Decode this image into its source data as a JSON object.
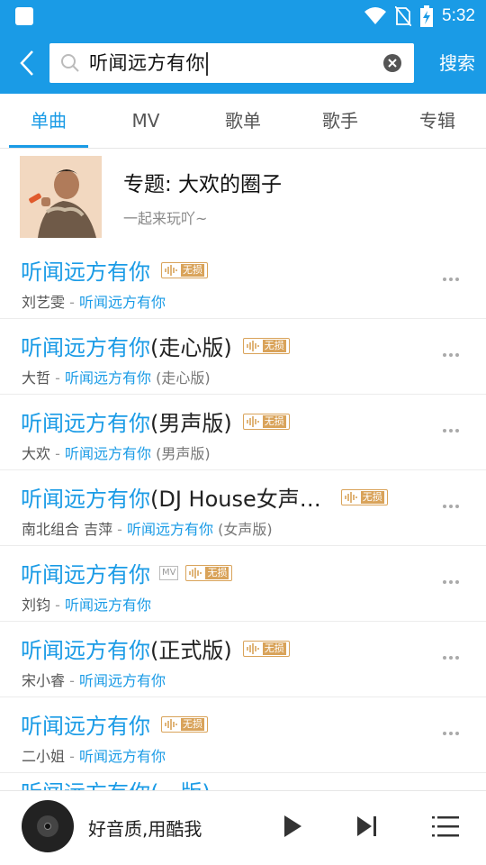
{
  "status_bar": {
    "time": "5:32"
  },
  "search": {
    "query": "听闻远方有你",
    "button_label": "搜索"
  },
  "tabs": [
    {
      "label": "单曲",
      "active": true
    },
    {
      "label": "MV",
      "active": false
    },
    {
      "label": "歌单",
      "active": false
    },
    {
      "label": "歌手",
      "active": false
    },
    {
      "label": "专辑",
      "active": false
    }
  ],
  "topic": {
    "title": "专题: 大欢的圈子",
    "subtitle": "一起来玩吖~"
  },
  "songs": [
    {
      "title_hl": "听闻远方有你",
      "title_rest": "",
      "artist": "刘艺雯",
      "album_hl": "听闻远方有你",
      "album_rest": "",
      "badge": "无损",
      "mv": ""
    },
    {
      "title_hl": "听闻远方有你",
      "title_rest": "(走心版)",
      "artist": "大哲",
      "album_hl": "听闻远方有你",
      "album_rest": " (走心版)",
      "badge": "无损",
      "mv": ""
    },
    {
      "title_hl": "听闻远方有你",
      "title_rest": "(男声版)",
      "artist": "大欢",
      "album_hl": "听闻远方有你",
      "album_rest": " (男声版)",
      "badge": "无损",
      "mv": ""
    },
    {
      "title_hl": "听闻远方有你",
      "title_rest": "(DJ House女声…",
      "artist": "南北组合 吉萍",
      "album_hl": "听闻远方有你",
      "album_rest": " (女声版)",
      "badge": "无损",
      "mv": ""
    },
    {
      "title_hl": "听闻远方有你",
      "title_rest": "",
      "artist": "刘钧",
      "album_hl": "听闻远方有你",
      "album_rest": "",
      "badge": "无损",
      "mv": "MV"
    },
    {
      "title_hl": "听闻远方有你",
      "title_rest": "(正式版)",
      "artist": "宋小睿",
      "album_hl": "听闻远方有你",
      "album_rest": "",
      "badge": "无损",
      "mv": ""
    },
    {
      "title_hl": "听闻远方有你",
      "title_rest": "",
      "artist": "二小姐",
      "album_hl": "听闻远方有你",
      "album_rest": "",
      "badge": "无损",
      "mv": ""
    }
  ],
  "partial_row": {
    "text": "听闻远方有你(…版)"
  },
  "player": {
    "text": "好音质,用酷我"
  },
  "colors": {
    "accent": "#1a9be6",
    "hq_badge": "#d9a35a"
  }
}
